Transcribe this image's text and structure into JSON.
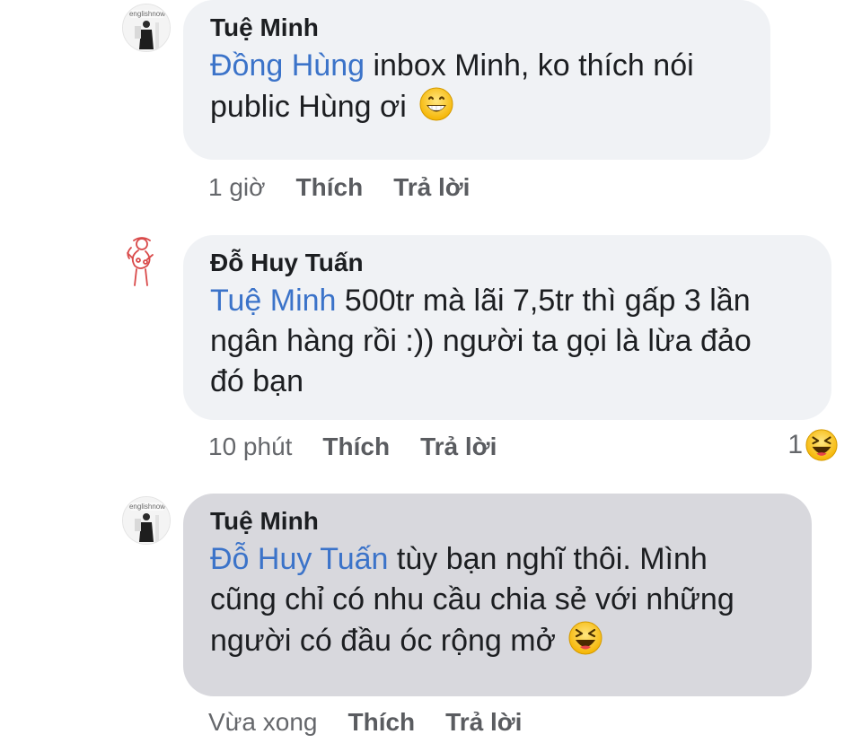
{
  "comments": [
    {
      "author": "Tuệ Minh",
      "avatar_text": "englishnow",
      "mention": "Đồng Hùng",
      "lines": [
        " inbox Minh, ko thích nói",
        "public Hùng ơi "
      ],
      "emoji": "grinning-face-icon",
      "time": "1 giờ",
      "like_label": "Thích",
      "reply_label": "Trả lời"
    },
    {
      "author": "Đỗ Huy Tuấn",
      "mention": "Tuệ Minh",
      "lines": [
        " 500tr mà lãi 7,5tr thì gấp 3 lần",
        "ngân hàng rồi :)) người ta gọi là lừa đảo",
        "đó bạn"
      ],
      "time": "10 phút",
      "like_label": "Thích",
      "reply_label": "Trả lời",
      "reaction_count": "1",
      "reaction_icon": "laughing-face-icon"
    },
    {
      "author": "Tuệ Minh",
      "avatar_text": "englishnow",
      "mention": "Đỗ Huy Tuấn",
      "lines": [
        " tùy bạn nghĩ thôi. Mình",
        "cũng chỉ có nhu cầu chia sẻ với những",
        "người có đầu óc rộng mở "
      ],
      "emoji": "laughing-face-icon",
      "time": "Vừa xong",
      "like_label": "Thích",
      "reply_label": "Trả lời"
    }
  ],
  "colors": {
    "bubble": "#f0f2f5",
    "bubble_selected": "#d8d8dd",
    "mention": "#3b73c9",
    "meta": "#65676b"
  }
}
